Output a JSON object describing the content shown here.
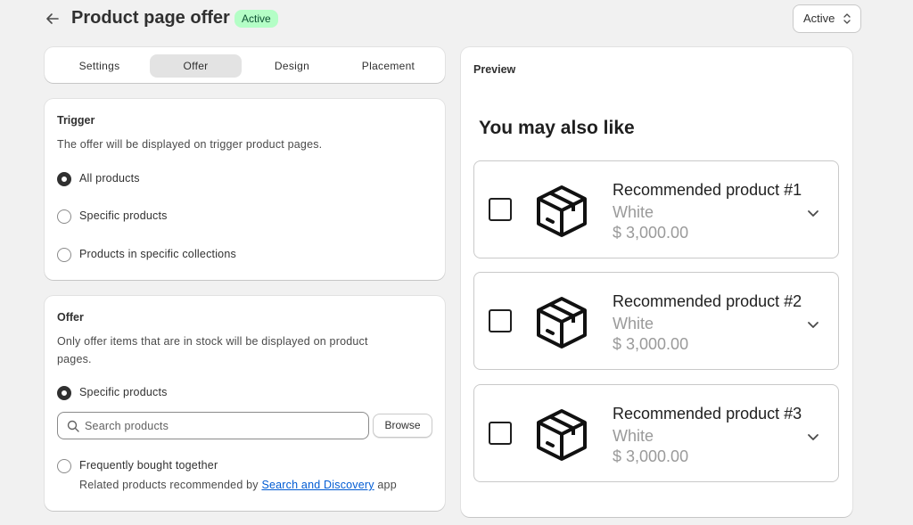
{
  "header": {
    "title": "Product page offer",
    "badge": "Active",
    "status_select": "Active",
    "icons": {
      "back": "arrow-left-icon",
      "select": "chevron-updown-icon"
    }
  },
  "tabs": [
    "Settings",
    "Offer",
    "Design",
    "Placement"
  ],
  "active_tab": "Offer",
  "trigger": {
    "title": "Trigger",
    "description": "The offer will be displayed on trigger product pages.",
    "options": [
      "All products",
      "Specific products",
      "Products in specific collections"
    ],
    "selected": "All products"
  },
  "offer": {
    "title": "Offer",
    "description_line1": "Only offer items that are in stock will be displayed on product",
    "description_line2": "pages.",
    "option_specific": "Specific products",
    "search_placeholder": "Search products",
    "browse_label": "Browse",
    "option_fbt": "Frequently bought together",
    "related_prefix": "Related products recommended by ",
    "related_link": "Search and Discovery",
    "related_suffix": " app",
    "selected": "Specific products"
  },
  "preview": {
    "title": "Preview",
    "heading": "You may also like",
    "products": [
      {
        "name": "Recommended product #1",
        "variant": "White",
        "price": "$ 3,000.00"
      },
      {
        "name": "Recommended product #2",
        "variant": "White",
        "price": "$ 3,000.00"
      },
      {
        "name": "Recommended product #3",
        "variant": "White",
        "price": "$ 3,000.00"
      }
    ]
  },
  "colors": {
    "badge_bg": "#b4fec6",
    "badge_text": "#0c5132",
    "link": "#005bd3",
    "page_bg": "#f1f1f1"
  }
}
